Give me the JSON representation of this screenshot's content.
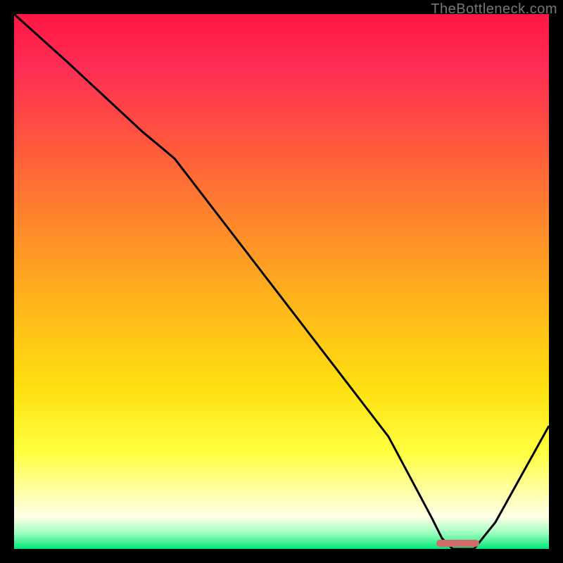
{
  "watermark": "TheBottleneck.com",
  "colors": {
    "curve": "#000000",
    "bar": "#d46a6a",
    "bg_black": "#000000"
  },
  "chart_data": {
    "type": "line",
    "title": "",
    "xlabel": "",
    "ylabel": "",
    "xlim": [
      0,
      100
    ],
    "ylim": [
      0,
      100
    ],
    "x": [
      0,
      10,
      24,
      30,
      40,
      50,
      60,
      70,
      78,
      80,
      82,
      86,
      90,
      95,
      100
    ],
    "values": [
      100,
      91,
      78,
      73,
      60,
      47,
      34,
      21,
      6,
      2,
      0,
      0,
      5,
      14,
      23
    ],
    "marker_bar": {
      "x_start": 79,
      "x_end": 87,
      "y": 0
    }
  }
}
